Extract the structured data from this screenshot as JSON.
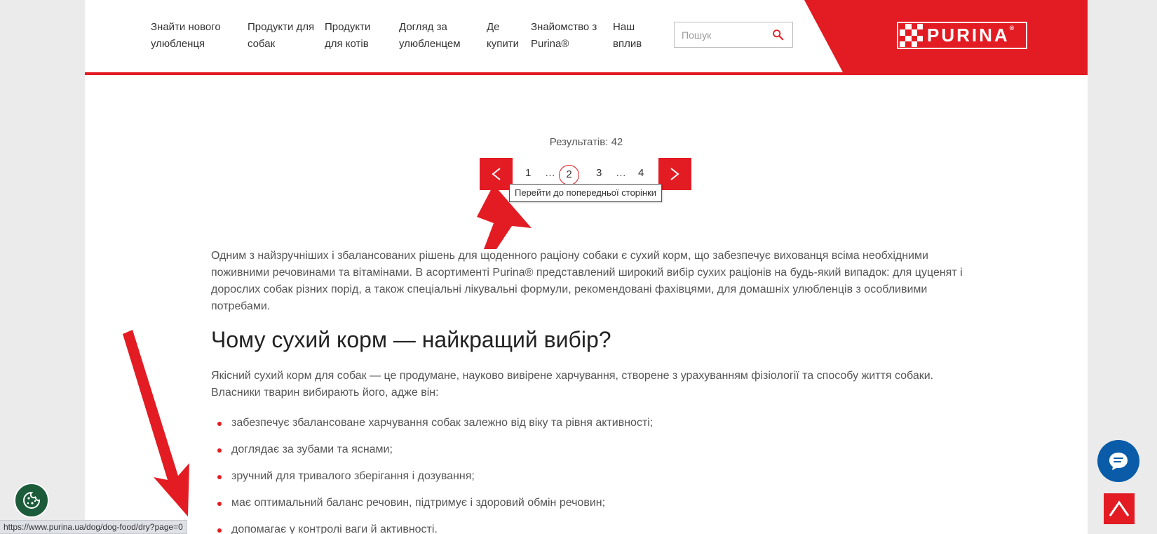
{
  "header": {
    "nav": [
      {
        "line1": "Знайти нового",
        "line2": "улюбленця"
      },
      {
        "line1": "Продукти для",
        "line2": "собак"
      },
      {
        "line1": "Продукти",
        "line2": "для котів"
      },
      {
        "line1": "Догляд за",
        "line2": "улюбленцем"
      },
      {
        "line1": "Де",
        "line2": "купити"
      },
      {
        "line1": "Знайомство з",
        "line2": "Purina®"
      },
      {
        "line1": "Наш",
        "line2": "вплив"
      }
    ],
    "search_placeholder": "Пошук",
    "logo_text": "PURINA",
    "logo_reg": "®",
    "accent_color": "#e31c23"
  },
  "pagination": {
    "results_text": "Результатів: 42",
    "prev_icon": "chevron-left-icon",
    "next_icon": "chevron-right-icon",
    "pages": [
      "1",
      "…",
      "2",
      "3",
      "…",
      "4"
    ],
    "current_page": "2",
    "tooltip": "Перейти до попередньої сторінки"
  },
  "content": {
    "intro": "Одним з найзручніших і збалансованих рішень для щоденного раціону собаки є сухий корм, що забезпечує вихованця всіма необхідними поживними речовинами та вітамінами. В асортименті Purina® представлений широкий вибір сухих раціонів на будь-який випадок: для цуценят і дорослих собак різних порід, а також спеціальні лікувальні формули, рекомендовані фахівцями, для домашніх улюбленців з особливими потребами.",
    "heading": "Чому сухий корм — найкращий вибір?",
    "paragraph": "Якісний сухий корм для собак — це продумане, науково вивірене харчування, створене з урахуванням фізіології та способу життя собаки. Власники тварин вибирають його, адже він:",
    "bullets": [
      "забезпечує збалансоване харчування собак залежно від віку та рівня активності;",
      "доглядає за зубами та яснами;",
      "зручний для тривалого зберігання і дозування;",
      "має оптимальний баланс речовин, підтримує і здоровий обмін речовин;",
      "допомагає у контролі ваги й активності."
    ]
  },
  "floating": {
    "cookie_icon": "cookie-icon",
    "chat_icon": "chat-icon",
    "totop_icon": "chevron-up-icon"
  },
  "status_url": "https://www.purina.ua/dog/dog-food/dry?page=0"
}
